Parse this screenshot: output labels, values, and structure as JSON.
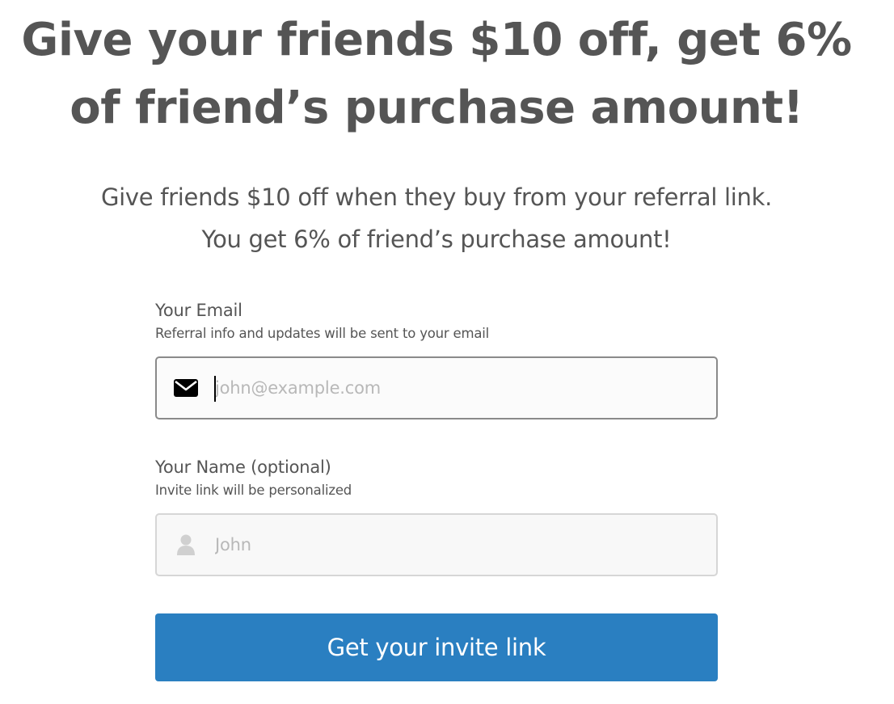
{
  "hero": {
    "headline": "Give your friends $10 off, get 6% of friend’s purchase amount!",
    "subheadline": "Give friends $10 off when they buy from your referral link. You get 6% of friend’s purchase amount!"
  },
  "form": {
    "email": {
      "label": "Your Email",
      "help": "Referral info and updates will be sent to your email",
      "placeholder": "john@example.com",
      "value": "",
      "icon": "envelope-icon"
    },
    "name": {
      "label": "Your Name (optional)",
      "help": "Invite link will be personalized",
      "placeholder": "John",
      "value": "",
      "icon": "user-icon"
    },
    "submit_label": "Get your invite link"
  },
  "colors": {
    "text": "#555555",
    "button": "#2a7fc1",
    "button_text": "#ffffff",
    "active_border": "#8a8a8a",
    "inactive_border": "#d6d6d6",
    "placeholder": "#b8b8b8"
  }
}
